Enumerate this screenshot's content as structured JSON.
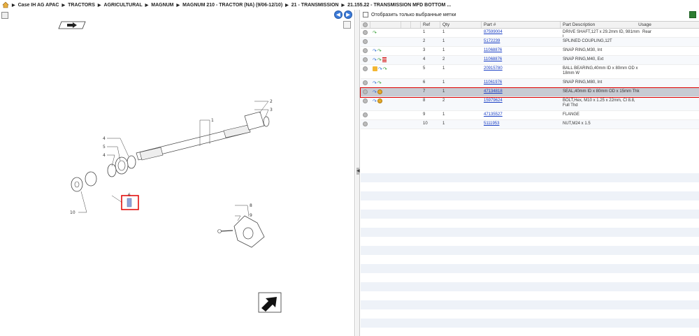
{
  "breadcrumb": [
    "Case IH AG APAC",
    "TRACTORS",
    "AGRICULTURAL",
    "MAGNUM",
    "MAGNUM 210 - TRACTOR (NA) (9/06-12/10)",
    "21 - TRANSMISSION",
    "21.155.22 - TRANSMISSION MFD BOTTOM ..."
  ],
  "filter": {
    "label": "Отобразить только выбранные метки",
    "checked": false
  },
  "columns": {
    "ref": "Ref",
    "qty": "Qty",
    "part": "Part #",
    "desc": "Part Description",
    "usage": "Usage"
  },
  "rows": [
    {
      "icons": [
        "plus",
        "green"
      ],
      "ref": "1",
      "qty": "1",
      "part": "87599004",
      "desc": "DRIVE SHAFT,12T x 29.2mm ID, 981mm L",
      "usage": "Rear"
    },
    {
      "icons": [
        "plus"
      ],
      "ref": "2",
      "qty": "1",
      "part": "5172239",
      "desc": "SPLINED COUPLING,12T",
      "usage": ""
    },
    {
      "icons": [
        "plus",
        "blue",
        "green"
      ],
      "ref": "3",
      "qty": "1",
      "part": "11068876",
      "desc": "SNAP RING,M30, Int",
      "usage": ""
    },
    {
      "icons": [
        "plus",
        "blue",
        "green",
        "info"
      ],
      "ref": "4",
      "qty": "2",
      "part": "11068876",
      "desc": "SNAP RING,M40, Ext",
      "usage": ""
    },
    {
      "icons": [
        "plus",
        "cart",
        "blue",
        "green"
      ],
      "ref": "5",
      "qty": "1",
      "part": "20915780",
      "desc": "BALL BEARING,40mm ID x 80mm OD x 18mm W",
      "usage": ""
    },
    {
      "icons": [
        "plus",
        "blue",
        "green"
      ],
      "ref": "6",
      "qty": "1",
      "part": "11061976",
      "desc": "SNAP RING,M80, Int",
      "usage": ""
    },
    {
      "icons": [
        "plus",
        "blue",
        "bearing"
      ],
      "ref": "7",
      "qty": "1",
      "part": "47134818",
      "desc": "SEAL,40mm ID x 80mm OD x 15mm Thk",
      "usage": "",
      "selected": true
    },
    {
      "icons": [
        "plus",
        "blue",
        "bearing"
      ],
      "ref": "8",
      "qty": "2",
      "part": "15979624",
      "desc": "BOLT,Hex, M10 x 1.25 x 22mm, Cl 8.8, Full Thd",
      "usage": ""
    },
    {
      "icons": [
        "plus"
      ],
      "ref": "9",
      "qty": "1",
      "part": "47135527",
      "desc": "FLANGE",
      "usage": ""
    },
    {
      "icons": [
        "plus"
      ],
      "ref": "10",
      "qty": "1",
      "part": "5111953",
      "desc": "NUT,M24 x 1.5",
      "usage": ""
    }
  ],
  "callouts": [
    "1",
    "2",
    "3",
    "4",
    "5",
    "4",
    "6",
    "7",
    "8",
    "9",
    "10"
  ],
  "colors": {
    "highlight": "#e00000",
    "link": "#1a3fc4",
    "nav": "#3b7ad9"
  }
}
